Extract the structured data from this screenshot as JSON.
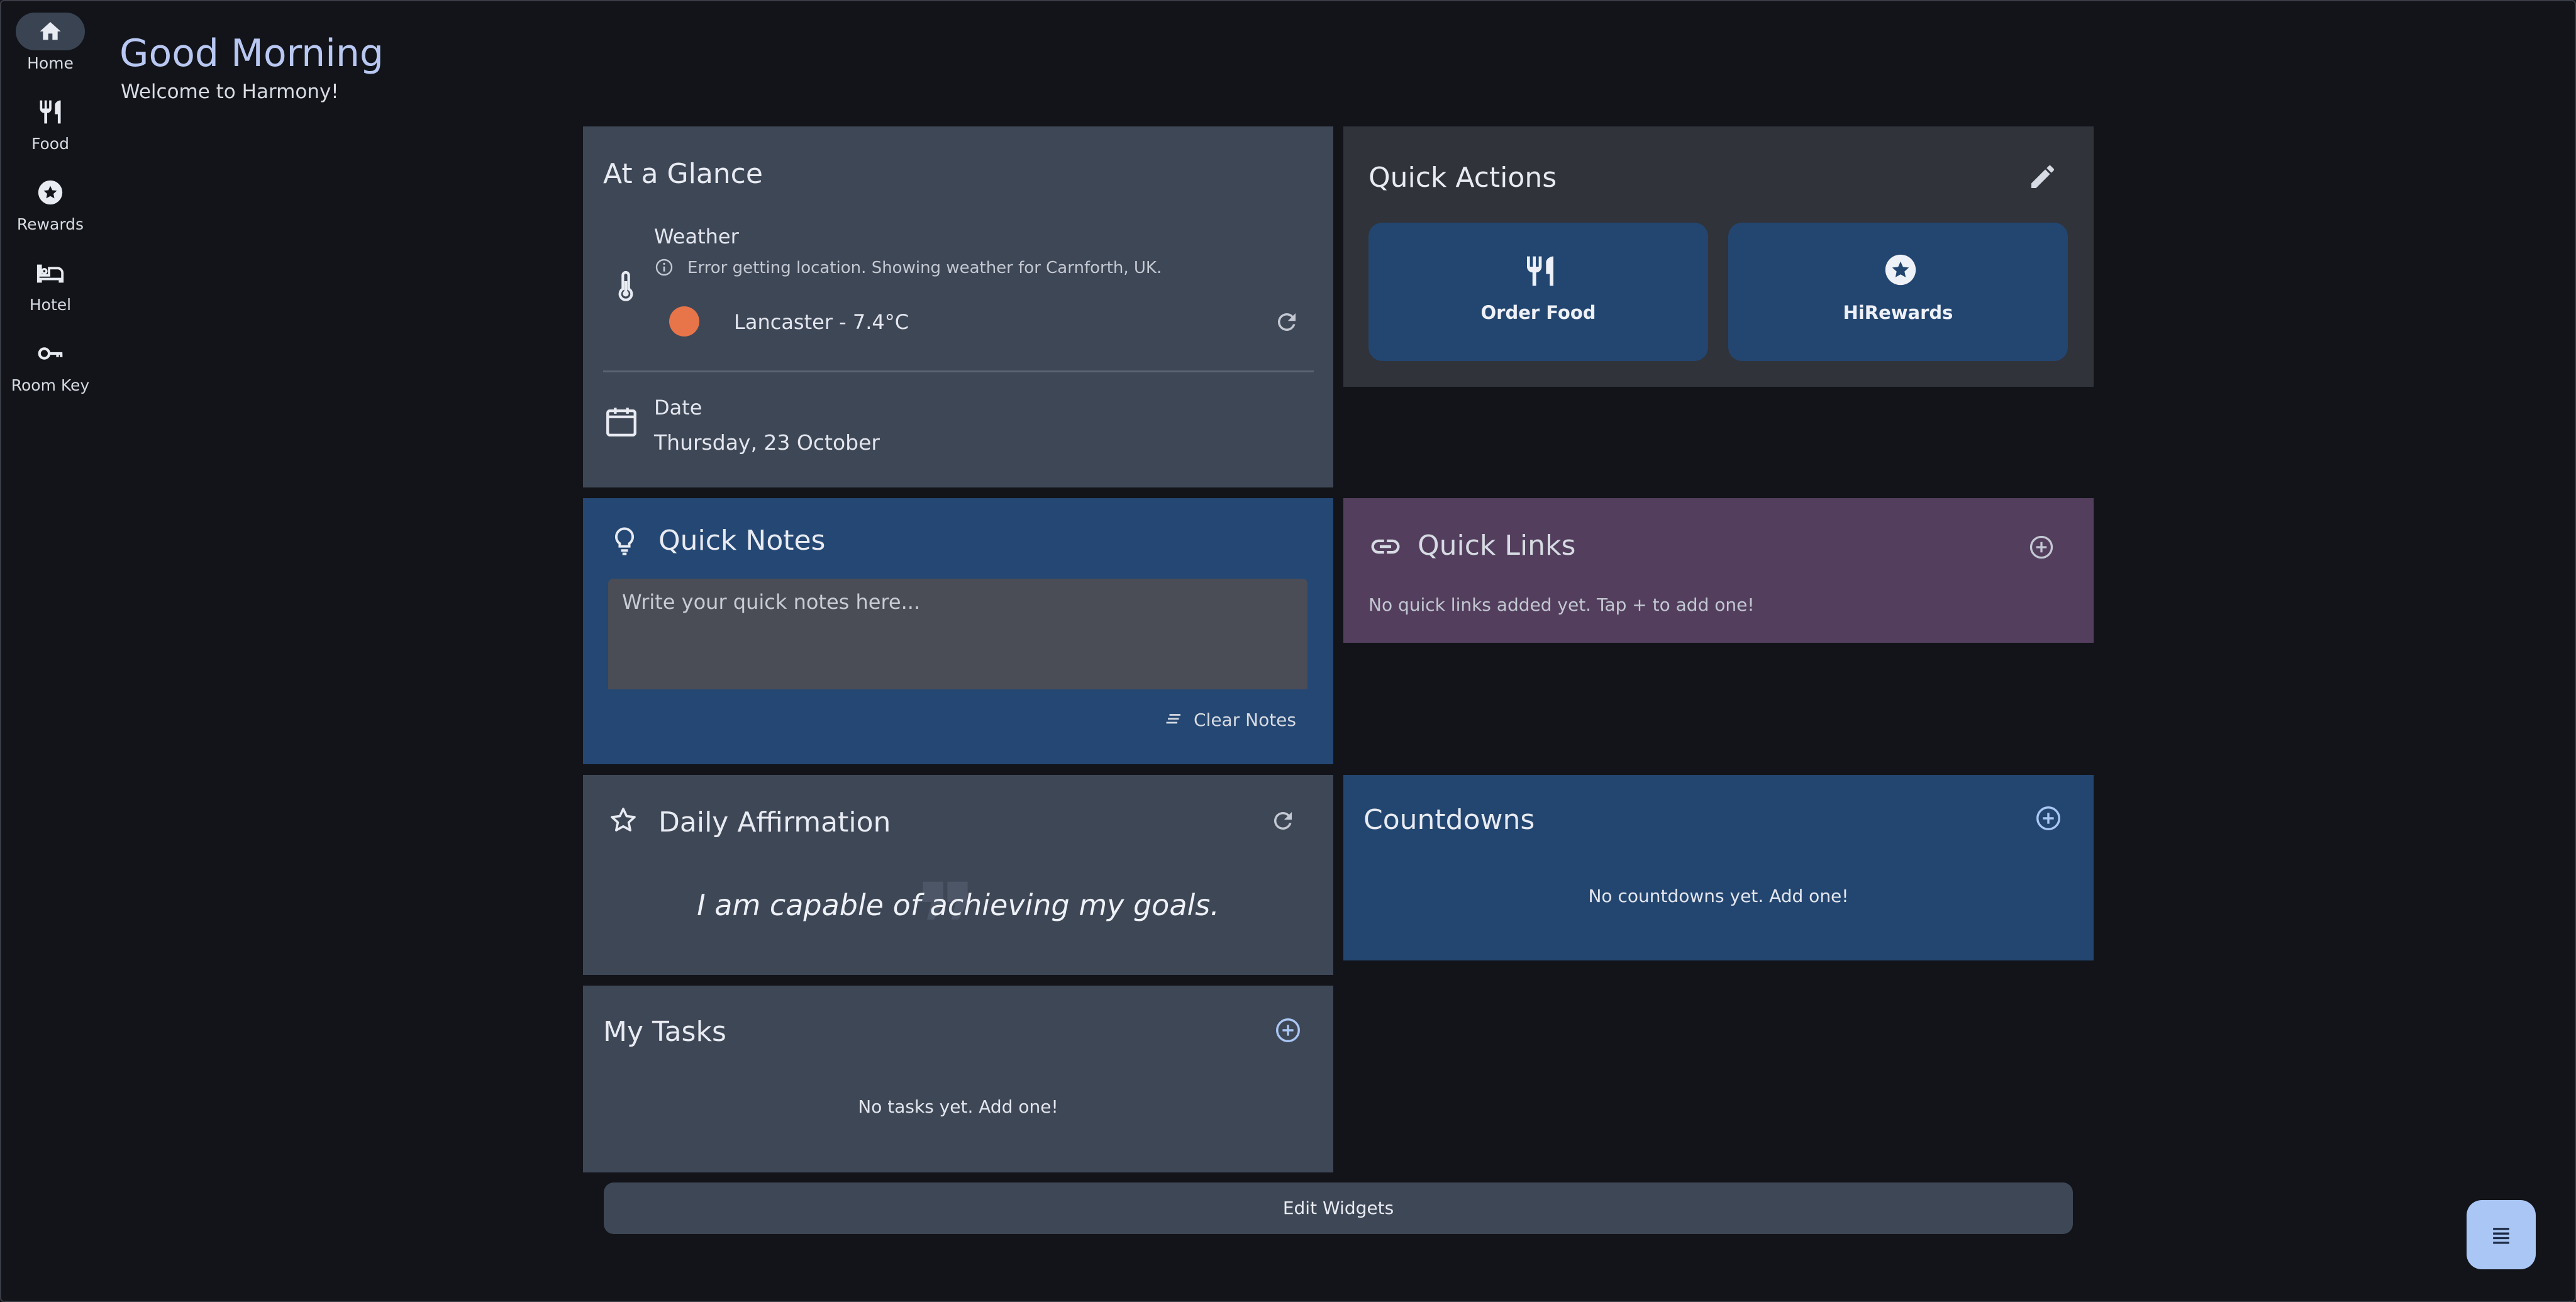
{
  "nav": {
    "items": [
      {
        "label": "Home",
        "icon": "home-icon",
        "active": true
      },
      {
        "label": "Food",
        "icon": "fork-knife-icon",
        "active": false
      },
      {
        "label": "Rewards",
        "icon": "star-circle-icon",
        "active": false
      },
      {
        "label": "Hotel",
        "icon": "bed-icon",
        "active": false
      },
      {
        "label": "Room Key",
        "icon": "key-icon",
        "active": false
      }
    ]
  },
  "greeting": {
    "title": "Good Morning",
    "subtitle": "Welcome to Harmony!"
  },
  "glance": {
    "title": "At a Glance",
    "weather_label": "Weather",
    "weather_error": "Error getting location. Showing weather for Carnforth, UK.",
    "weather_value": "Lancaster - 7.4°C",
    "date_label": "Date",
    "date_value": "Thursday, 23 October"
  },
  "quick_actions": {
    "title": "Quick Actions",
    "buttons": [
      {
        "label": "Order Food",
        "icon": "fork-knife-icon"
      },
      {
        "label": "HiRewards",
        "icon": "star-circle-icon"
      }
    ]
  },
  "quick_notes": {
    "title": "Quick Notes",
    "placeholder": "Write your quick notes here...",
    "clear_label": "Clear Notes"
  },
  "quick_links": {
    "title": "Quick Links",
    "empty": "No quick links added yet. Tap + to add one!"
  },
  "affirmation": {
    "title": "Daily Affirmation",
    "text": "I am capable of achieving my goals."
  },
  "countdowns": {
    "title": "Countdowns",
    "empty": "No countdowns yet. Add one!"
  },
  "tasks": {
    "title": "My Tasks",
    "empty": "No tasks yet. Add one!"
  },
  "footer": {
    "edit_widgets_label": "Edit Widgets"
  },
  "colors": {
    "background": "#121419",
    "card": "#3e4756",
    "card_blue": "#244773",
    "card_purple": "#533f5d",
    "accent": "#a9c6f5",
    "weather_sun": "#e8744a"
  }
}
